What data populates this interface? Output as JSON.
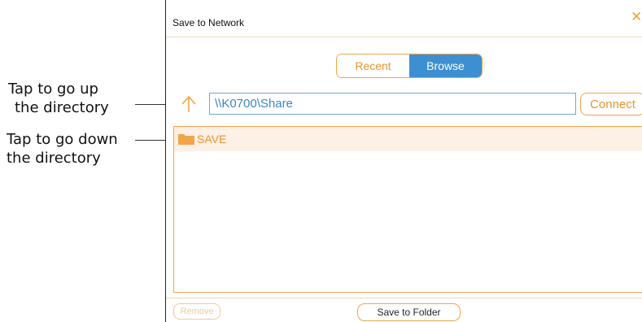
{
  "annotations": {
    "up": {
      "line1": "Tap to go up",
      "line2": "the directory"
    },
    "down": {
      "line1": "Tap to go down",
      "line2": "the directory"
    }
  },
  "dialog": {
    "title": "Save to Network",
    "close_icon": "close-icon",
    "tabs": [
      {
        "label": "Recent",
        "selected": false
      },
      {
        "label": "Browse",
        "selected": true
      }
    ],
    "path_value": "\\\\K0700\\Share",
    "up_icon": "arrow-up-icon",
    "connect_label": "Connect",
    "folders": [
      {
        "label": "SAVE",
        "icon": "folder-icon"
      }
    ],
    "remove_label": "Remove",
    "save_label": "Save to Folder"
  },
  "colors": {
    "accent_orange": "#f0a64a",
    "selected_blue": "#3d8fd1",
    "path_text_blue": "#3c86c6",
    "list_highlight": "#fdf0e4"
  }
}
